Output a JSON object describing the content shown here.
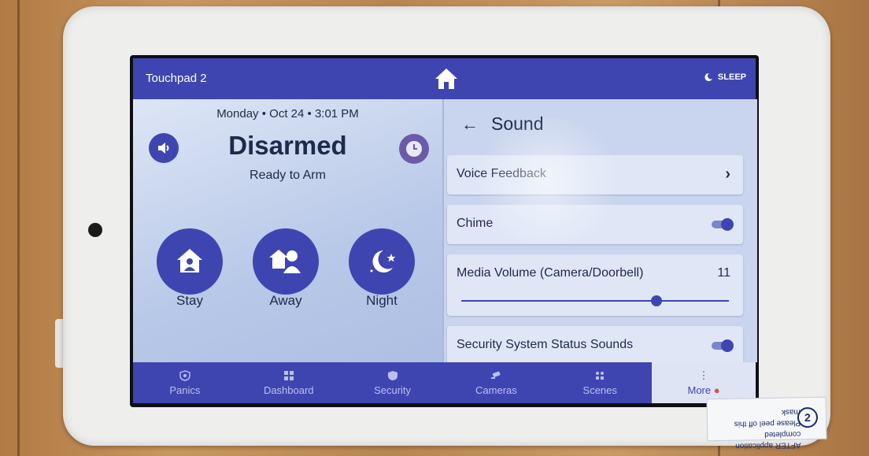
{
  "header": {
    "device_name": "Touchpad 2",
    "sleep_label": "SLEEP"
  },
  "status_panel": {
    "day": "Monday",
    "date": "Oct 24",
    "time": "3:01 PM",
    "status": "Disarmed",
    "substatus": "Ready to Arm",
    "arm_modes": [
      {
        "label": "Stay",
        "icon": "house-person-icon"
      },
      {
        "label": "Away",
        "icon": "person-leaving-icon"
      },
      {
        "label": "Night",
        "icon": "moon-stars-icon"
      }
    ]
  },
  "sound": {
    "title": "Sound",
    "voice_feedback": "Voice Feedback",
    "chime": {
      "label": "Chime",
      "on": true
    },
    "media_volume": {
      "label": "Media Volume (Camera/Doorbell)",
      "value": "11",
      "fraction": 0.73
    },
    "status_sounds": {
      "label": "Security System Status Sounds",
      "on": true
    }
  },
  "nav": [
    {
      "label": "Panics",
      "icon": "shield-star-icon"
    },
    {
      "label": "Dashboard",
      "icon": "grid-icon"
    },
    {
      "label": "Security",
      "icon": "shield-icon"
    },
    {
      "label": "Cameras",
      "icon": "camera-icon"
    },
    {
      "label": "Scenes",
      "icon": "scenes-icon"
    },
    {
      "label": "More",
      "icon": "more-icon",
      "active": true
    }
  ],
  "sticker": {
    "number": "2",
    "line1": "AFTER application completed",
    "line2": "Please peel off this mask"
  },
  "colors": {
    "accent": "#3f45b0",
    "panel": "#c9d5ee"
  }
}
